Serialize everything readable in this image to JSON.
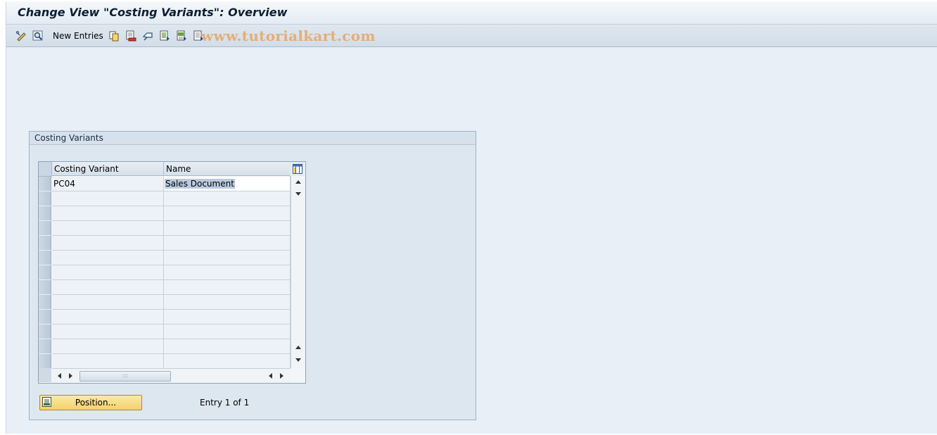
{
  "window": {
    "title": "Change View \"Costing Variants\": Overview"
  },
  "toolbar": {
    "new_entries_label": "New Entries",
    "watermark": "www.tutorialkart.com",
    "icons": [
      "display-change-icon",
      "find-icon",
      "copy-icon",
      "delete-icon",
      "undo-change-icon",
      "select-all-icon",
      "select-block-icon",
      "deselect-all-icon"
    ]
  },
  "group": {
    "title": "Costing Variants",
    "table": {
      "columns": [
        "Costing Variant",
        "Name"
      ],
      "rows": [
        {
          "variant": "PC04",
          "name": "Sales Document"
        },
        {
          "variant": "",
          "name": ""
        },
        {
          "variant": "",
          "name": ""
        },
        {
          "variant": "",
          "name": ""
        },
        {
          "variant": "",
          "name": ""
        },
        {
          "variant": "",
          "name": ""
        },
        {
          "variant": "",
          "name": ""
        },
        {
          "variant": "",
          "name": ""
        },
        {
          "variant": "",
          "name": ""
        },
        {
          "variant": "",
          "name": ""
        },
        {
          "variant": "",
          "name": ""
        },
        {
          "variant": "",
          "name": ""
        },
        {
          "variant": "",
          "name": ""
        }
      ]
    },
    "position_button_label": "Position...",
    "entry_status": "Entry 1 of 1"
  },
  "colors": {
    "background": "#e8eff6",
    "title_text": "#0c1e33",
    "position_button": "#f2d26b",
    "selection": "#b9cbe0",
    "watermark": "#e8a86a"
  }
}
